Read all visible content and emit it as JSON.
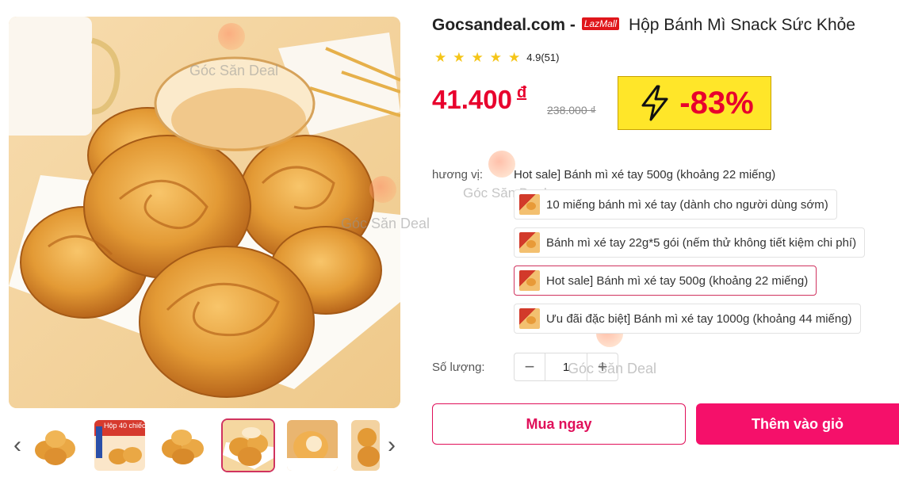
{
  "product": {
    "shop_name": "Gocsandeal.com -",
    "mall_badge": "LazMall",
    "title": "Hộp Bánh Mì Snack Sức Khỏe",
    "rating_value": "4.9(51)",
    "stars": 5,
    "price": "41.400",
    "currency": "đ",
    "original_price": "238.000 ₫",
    "discount": "-83%"
  },
  "watermark": "Góc Săn Deal",
  "variants": {
    "label": "hương vị:",
    "selected_text": "Hot sale] Bánh mì xé tay 500g (khoảng 22 miếng)",
    "options": [
      {
        "label": "10 miếng bánh mì xé tay (dành cho người dùng sớm)",
        "selected": false
      },
      {
        "label": "Bánh mì xé tay 22g*5 gói (nếm thử không tiết kiệm chi phí)",
        "selected": false
      },
      {
        "label": "Hot sale] Bánh mì xé tay 500g (khoảng 22 miếng)",
        "selected": true
      },
      {
        "label": "Ưu đãi đặc biệt] Bánh mì xé tay 1000g (khoảng 44 miếng)",
        "selected": false
      }
    ]
  },
  "quantity": {
    "label": "Số lượng:",
    "value": "1",
    "minus": "−",
    "plus": "+"
  },
  "actions": {
    "buy_now": "Mua ngay",
    "add_to_cart": "Thêm vào giỏ"
  },
  "gallery": {
    "prev_icon": "‹",
    "next_icon": "›",
    "thumb2_caption": "Hộp 40 chiếc",
    "selected_index": 3
  },
  "colors": {
    "price": "#e8002d",
    "accent": "#f5106a",
    "discount_bg": "#ffe629",
    "star": "#f5c518"
  }
}
